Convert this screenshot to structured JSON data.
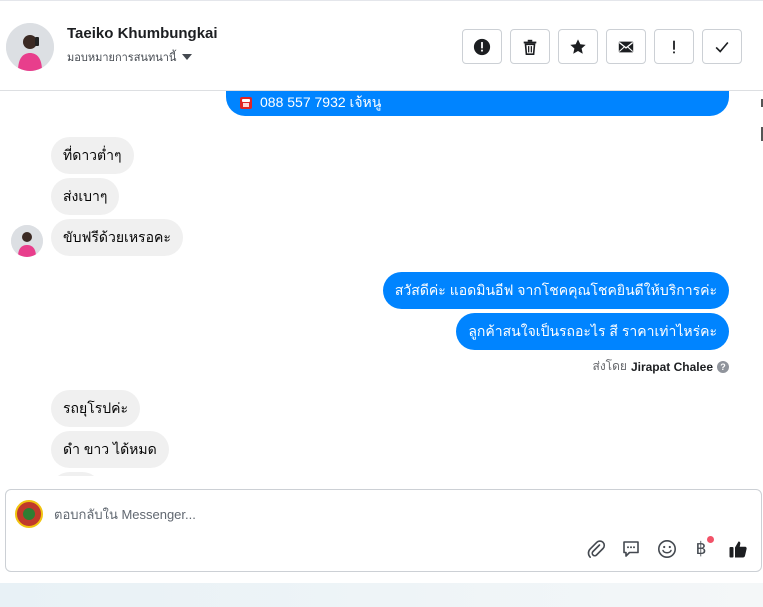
{
  "header": {
    "contact_name": "Taeiko Khumbungkai",
    "assign_label": "มอบหมายการสนทนานี้",
    "actions": [
      {
        "name": "mark-spam-button",
        "icon": "alert-circle-icon"
      },
      {
        "name": "delete-button",
        "icon": "trash-icon"
      },
      {
        "name": "star-button",
        "icon": "star-icon"
      },
      {
        "name": "mark-unread-button",
        "icon": "envelope-icon"
      },
      {
        "name": "follow-up-button",
        "icon": "exclamation-icon"
      },
      {
        "name": "mark-done-button",
        "icon": "check-icon"
      }
    ]
  },
  "thread": {
    "top_outgoing_partial": "088 557 7932 เจ้หนู",
    "incoming_group_1": [
      "ที่ดาวต่ำๆ",
      "ส่งเบาๆ",
      "ขับฟรีด้วยเหรอคะ"
    ],
    "outgoing_group": [
      "สวัสดีค่ะ แอดมินอีฟ จากโชคคุณโชคยินดีให้บริการค่ะ",
      "ลูกค้าสนใจเป็นรถอะไร สี ราคาเท่าไหร่คะ"
    ],
    "sent_by_prefix": "ส่งโดย",
    "sent_by_name": "Jirapat Chalee",
    "incoming_group_2": [
      "รถยุโรปค่ะ",
      "ดำ ขาว ได้หมด"
    ]
  },
  "composer": {
    "placeholder": "ตอบกลับใน Messenger...",
    "currency_symbol": "฿"
  },
  "colors": {
    "outgoing_bubble": "#0084ff",
    "incoming_bubble": "#f0f0f0",
    "notification_dot": "#f25268"
  }
}
